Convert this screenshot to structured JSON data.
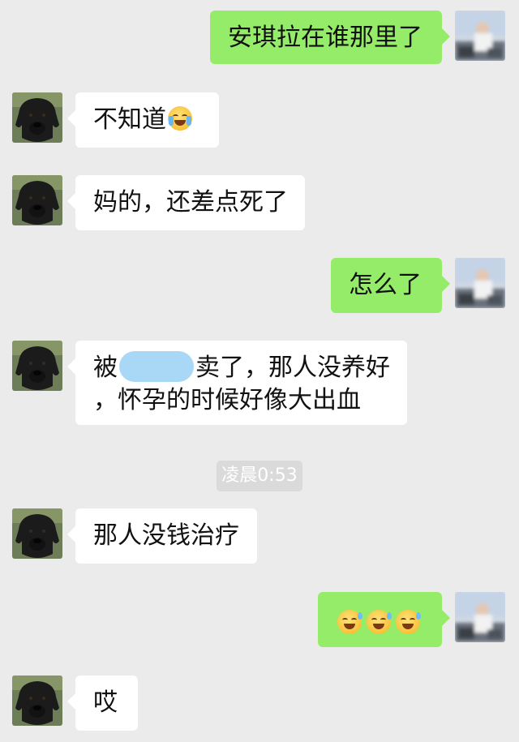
{
  "messages": [
    {
      "side": "out",
      "text": "安琪拉在谁那里了"
    },
    {
      "side": "in",
      "text": "不知道",
      "emoji": "loudly-crying-face"
    },
    {
      "side": "in",
      "text": "妈的，还差点死了"
    },
    {
      "side": "out",
      "text": "怎么了"
    },
    {
      "side": "in",
      "line1_before": "被",
      "line1_after": "卖了，那人没养好",
      "line2": "，怀孕的时候好像大出血",
      "redaction": "redacted-name"
    },
    {
      "side": "in",
      "text": "那人没钱治疗"
    },
    {
      "side": "out",
      "emoji": "grinning-squinting-sweat-face",
      "emoji_count": 3
    },
    {
      "side": "in",
      "text": "哎"
    }
  ],
  "timestamp": "凌晨0:53",
  "colors": {
    "background": "#ebebeb",
    "outgoing_bubble": "#95ec69",
    "incoming_bubble": "#ffffff",
    "redaction": "#a9d8f6",
    "timestamp_bg": "#dadada"
  },
  "icons": {
    "contact_avatar": "black-dog-avatar",
    "self_avatar": "blurred-user-avatar"
  }
}
